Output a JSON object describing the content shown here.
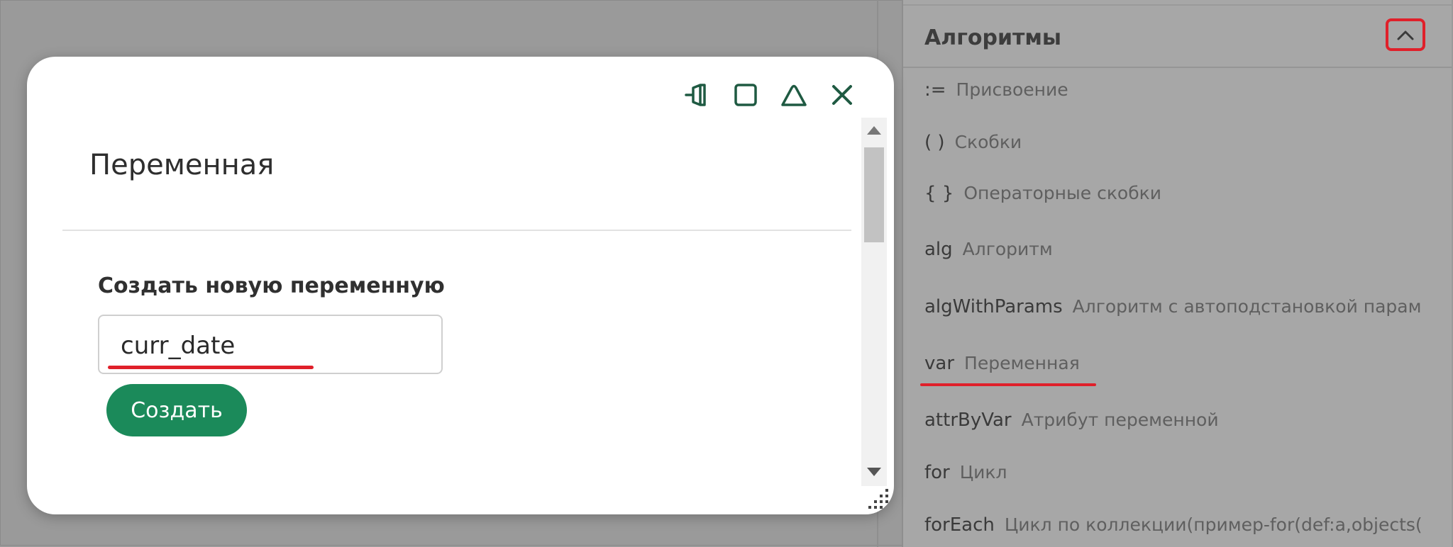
{
  "panel": {
    "title": "Алгоритмы",
    "items": [
      {
        "key": ":=",
        "desc": "Присвоение"
      },
      {
        "key": "( )",
        "desc": "Скобки"
      },
      {
        "key": "{ }",
        "desc": "Операторные скобки"
      },
      {
        "key": "alg",
        "desc": "Алгоритм"
      },
      {
        "key": "algWithParams",
        "desc": "Алгоритм с автоподстановкой парам"
      },
      {
        "key": "var",
        "desc": "Переменная"
      },
      {
        "key": "attrByVar",
        "desc": "Атрибут переменной"
      },
      {
        "key": "for",
        "desc": "Цикл"
      },
      {
        "key": "forEach",
        "desc": "Цикл по коллекции(пример-for(def:a,objects("
      }
    ]
  },
  "dialog": {
    "title": "Переменная",
    "field_label": "Создать новую переменную",
    "input_value": "curr_date",
    "create_label": "Создать"
  },
  "colors": {
    "accent": "#1b8a5a",
    "highlight": "#e0202a",
    "icon": "#1f5a42"
  }
}
